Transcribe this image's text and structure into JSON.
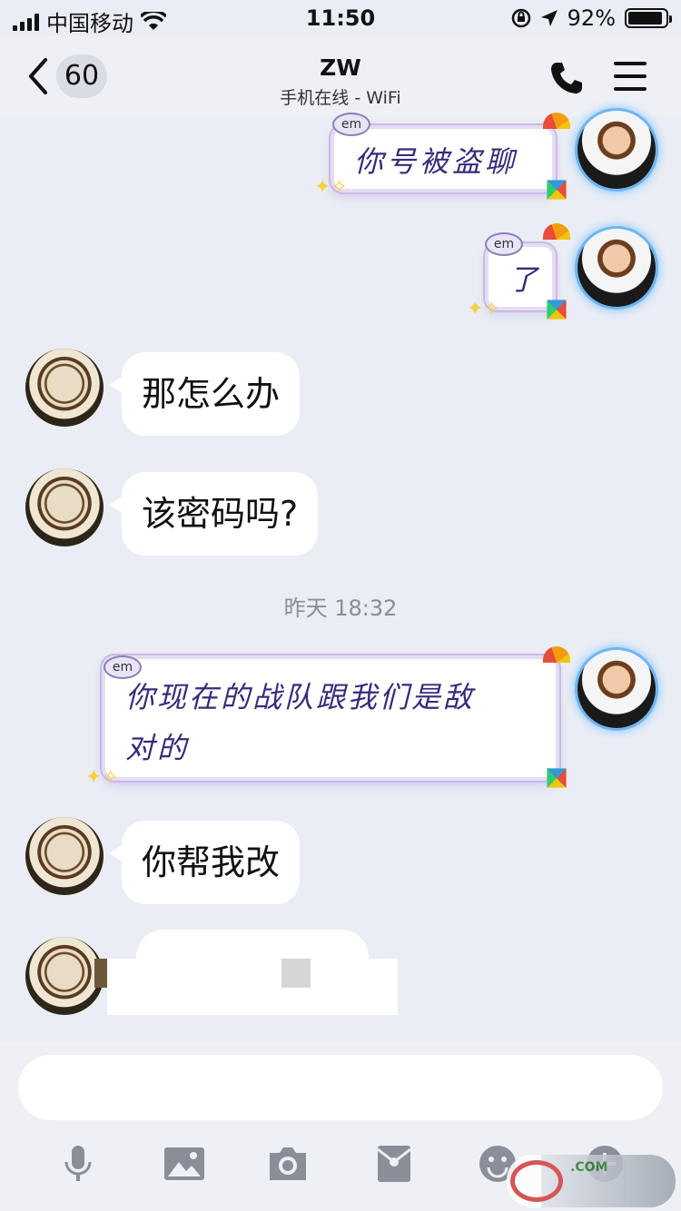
{
  "status": {
    "carrier": "中国移动",
    "time": "11:50",
    "battery_text": "92%",
    "battery_level": 0.92
  },
  "nav": {
    "back_badge": "60",
    "title": "ZW",
    "subtitle": "手机在线 - WiFi"
  },
  "messages": {
    "m1": "你号被盗聊",
    "m2": "了",
    "m3": "那怎么办",
    "m4": "该密码吗?",
    "timestamp": "昨天 18:32",
    "m5_line1": "你现在的战队跟我们是敌",
    "m5_line2": "对的",
    "m6": "你帮我改",
    "em": "em"
  },
  "watermark": {
    "text": ".COM"
  },
  "colors": {
    "background": "#eaedf4",
    "bubble_out_text": "#3a2a7a",
    "timestamp": "#8a8d94",
    "tool_icons": "#8a8e99"
  }
}
